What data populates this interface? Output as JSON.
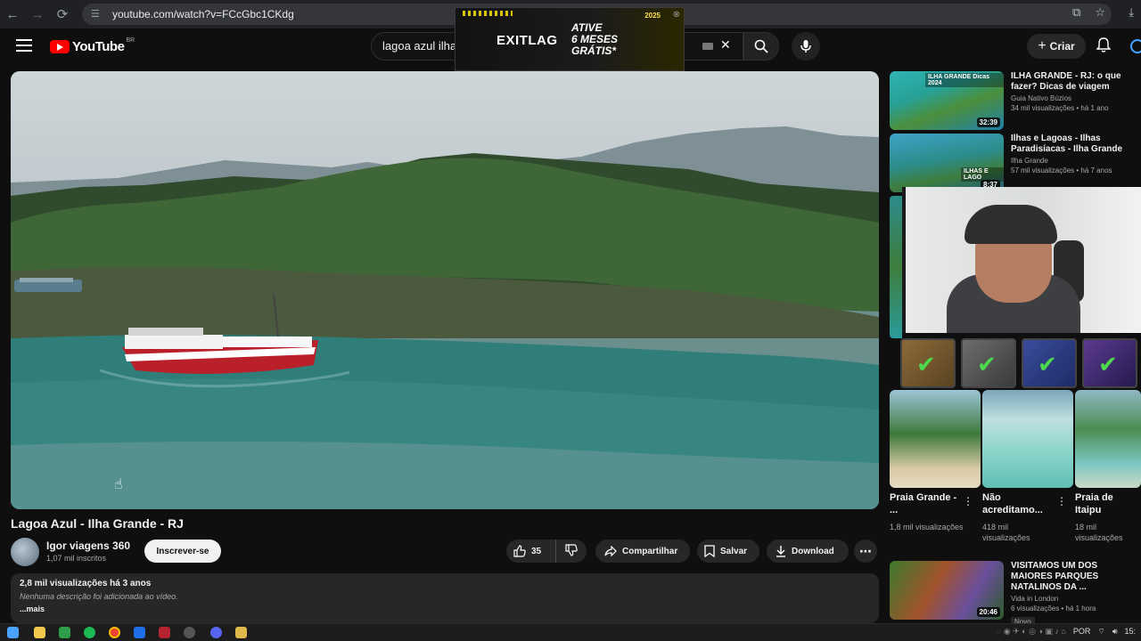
{
  "browser": {
    "url": "youtube.com/watch?v=FCcGbc1CKdg"
  },
  "ad": {
    "brand": "EXITLAG",
    "promo_line1": "ATIVE",
    "promo_line2": "6 MESES",
    "promo_line3": "GRÁTIS*",
    "year": "2025"
  },
  "header": {
    "logo": "YouTube",
    "country": "BR",
    "search_value": "lagoa azul ilha",
    "create_label": "Criar"
  },
  "video": {
    "title": "Lagoa Azul - Ilha Grande - RJ",
    "channel": "Igor viagens 360",
    "subscribers": "1,07 mil inscritos",
    "subscribe_label": "Inscrever-se",
    "likes": "35",
    "share_label": "Compartilhar",
    "save_label": "Salvar",
    "download_label": "Download",
    "views_date": "2,8 mil visualizações  há 3 anos",
    "description": "Nenhuma descrição foi adicionada ao vídeo.",
    "more_label": "...mais"
  },
  "recommendations": [
    {
      "title": "ILHA GRANDE - RJ: o que fazer? Dicas de viagem",
      "channel": "Guia Nativo Búzios",
      "stats": "34 mil visualizações • há 1 ano",
      "duration": "32:39",
      "overlay": "ILHA GRANDE Dicas 2024"
    },
    {
      "title": "Ilhas e Lagoas - Ilhas Paradisíacas - Ilha Grande",
      "channel": "Ilha Grande",
      "stats": "57 mil visualizações • há 7 anos",
      "duration": "8:37",
      "overlay": "ILHAS E LAGO"
    },
    {
      "title": "VISITAMOS UM DOS MAIORES PARQUES NATALINOS DA ...",
      "channel": "Vida in London",
      "stats": "6 visualizações • há 1 hora",
      "duration": "20:46",
      "badge": "Novo"
    }
  ],
  "shorts": [
    {
      "title": "Praia Grande - ...",
      "views": "1,8 mil visualizações"
    },
    {
      "title": "Não acreditamo...",
      "views": "418 mil visualizações"
    },
    {
      "title": "Praia de Itaipu",
      "views": "18 mil visualizações"
    }
  ],
  "taskbar": {
    "language": "POR",
    "clock": "15:"
  },
  "colors": {
    "background": "#0f0f0f",
    "youtube_red": "#ff0000",
    "pill": "#272727",
    "accent_blue": "#3ea6ff",
    "check_green": "#4cd94c"
  }
}
